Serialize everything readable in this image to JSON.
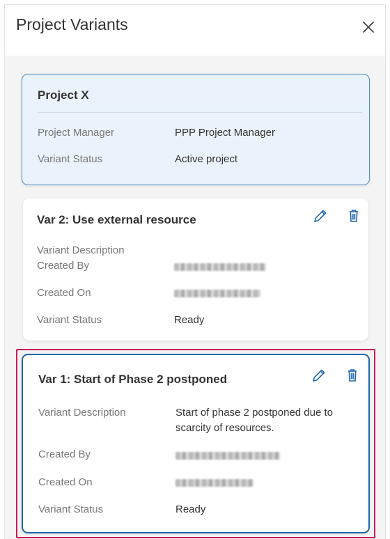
{
  "header": {
    "title": "Project Variants",
    "close_icon": "close-icon"
  },
  "active_card": {
    "title": "Project X",
    "rows": [
      {
        "label": "Project Manager",
        "value": "PPP Project Manager"
      },
      {
        "label": "Variant Status",
        "value": "Active project"
      }
    ],
    "accent": "#4e8fc4",
    "background": "#eaf3fb"
  },
  "variants": [
    {
      "title": "Var 2: Use external resource",
      "description_label": "Variant Description",
      "description": "",
      "created_by_label": "Created By",
      "created_by": "",
      "created_on_label": "Created On",
      "created_on": "",
      "status_label": "Variant Status",
      "status": "Ready",
      "edit_icon": "pencil-icon",
      "delete_icon": "trash-icon"
    },
    {
      "title": "Var 1: Start of Phase 2 postponed",
      "description_label": "Variant Description",
      "description": "Start of phase 2 postponed due to scarcity of resources.",
      "created_by_label": "Created By",
      "created_by": "",
      "created_on_label": "Created On",
      "created_on": "",
      "status_label": "Variant Status",
      "status": "Ready",
      "edit_icon": "pencil-icon",
      "delete_icon": "trash-icon",
      "selected_border": "#1f66b0",
      "highlight_border": "#c9195d"
    }
  ],
  "icon_color": "#1f66b0"
}
